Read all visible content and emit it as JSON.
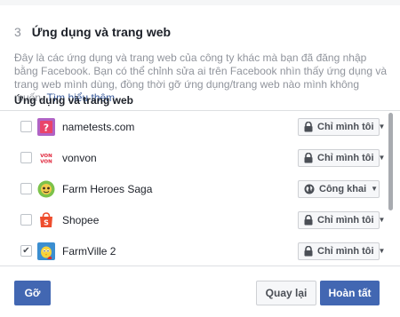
{
  "step": {
    "number": "3",
    "title": "Ứng dụng và trang web"
  },
  "description": {
    "text": "Đây là các ứng dụng và trang web của công ty khác mà bạn đã đăng nhập bằng Facebook. Bạn có thể chỉnh sửa ai trên Facebook nhìn thấy ứng dụng và trang web mình dùng, đồng thời gỡ ứng dụng/trang web nào mình không muốn.",
    "learn_more": "Tìm hiểu thêm"
  },
  "section_label": "Ứng dụng và trang web",
  "apps": [
    {
      "name": "nametests.com",
      "checked": false,
      "icon": "nametests-icon",
      "privacy": "Chỉ mình tôi",
      "privacy_icon": "lock-icon"
    },
    {
      "name": "vonvon",
      "checked": false,
      "icon": "vonvon-icon",
      "icon_text": "VON VON",
      "privacy": "Chỉ mình tôi",
      "privacy_icon": "lock-icon"
    },
    {
      "name": "Farm Heroes Saga",
      "checked": false,
      "icon": "farm-heroes-icon",
      "privacy": "Công khai",
      "privacy_icon": "globe-icon"
    },
    {
      "name": "Shopee",
      "checked": false,
      "icon": "shopee-icon",
      "privacy": "Chỉ mình tôi",
      "privacy_icon": "lock-icon"
    },
    {
      "name": "FarmVille 2",
      "checked": true,
      "icon": "farmville-icon",
      "privacy": "Chỉ mình tôi",
      "privacy_icon": "lock-icon"
    }
  ],
  "buttons": {
    "remove": "Gỡ",
    "back": "Quay lại",
    "done": "Hoàn tất"
  },
  "colors": {
    "primary": "#4267b2",
    "link": "#365899",
    "muted_text": "#90949c"
  }
}
